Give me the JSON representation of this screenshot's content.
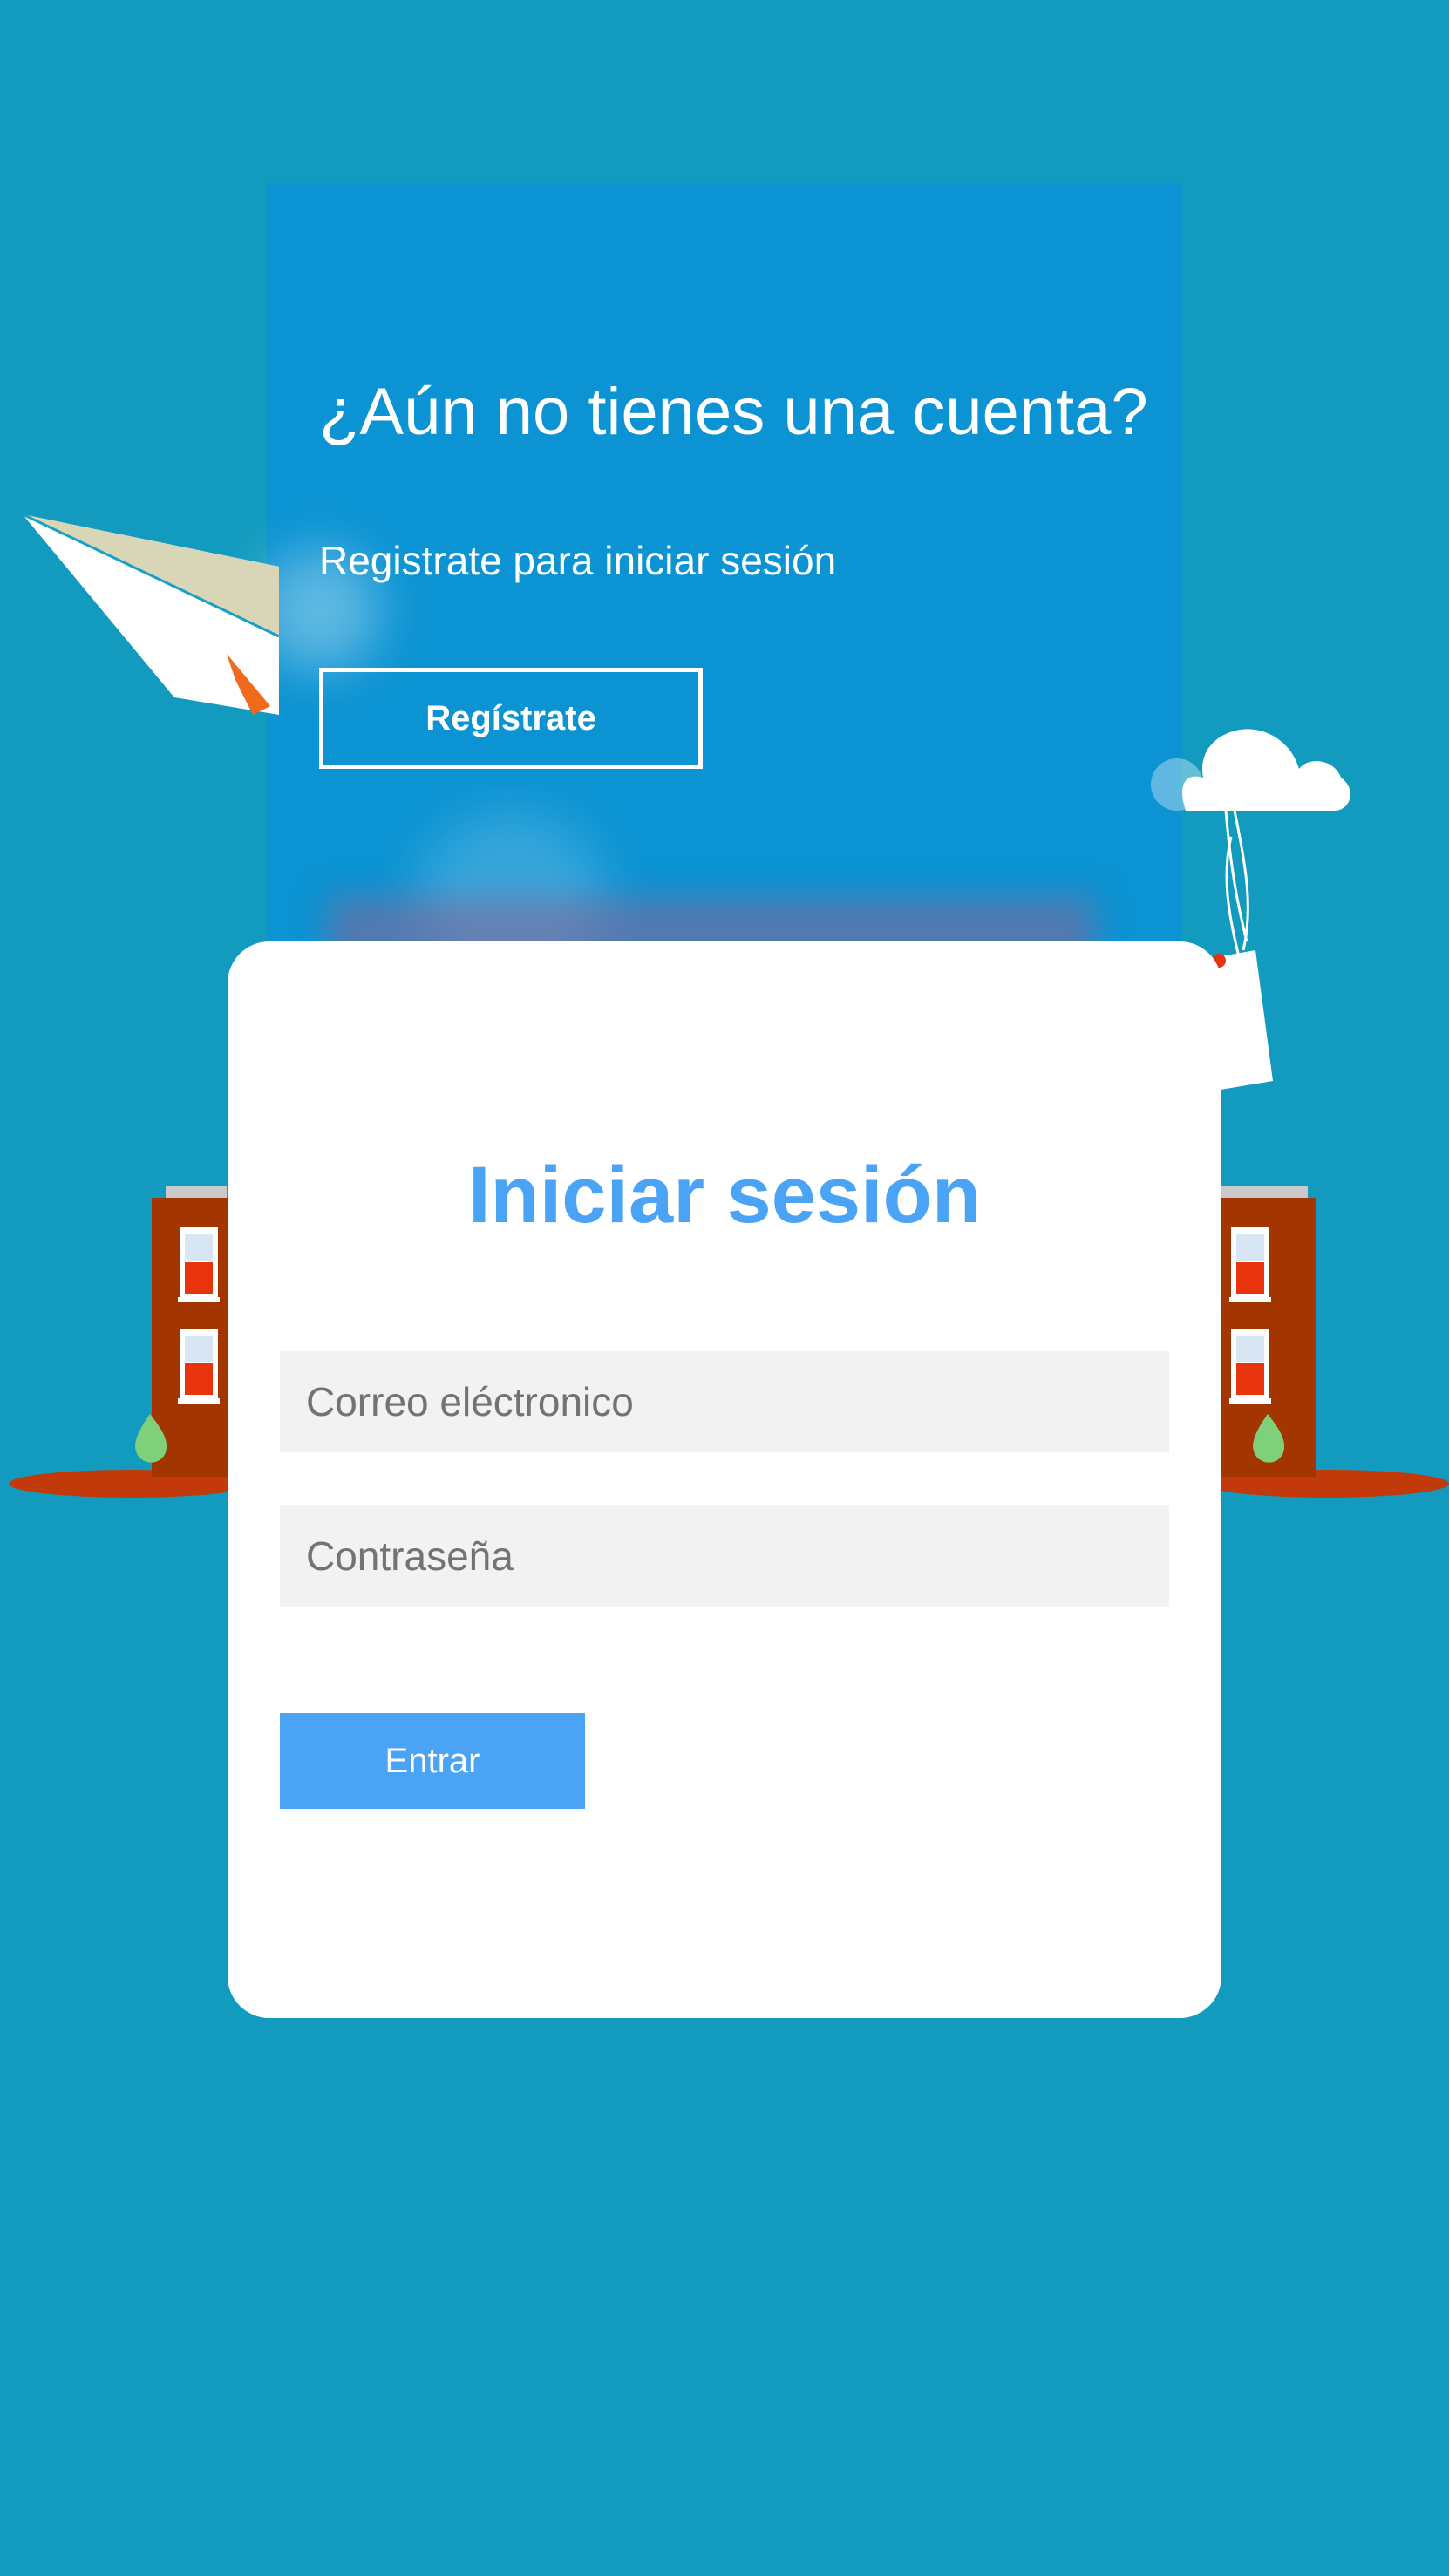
{
  "register": {
    "title": "¿Aún no tienes una cuenta?",
    "subtitle": "Registrate para iniciar sesión",
    "button_label": "Regístrate"
  },
  "login": {
    "title": "Iniciar sesión",
    "email_placeholder": "Correo eléctronico",
    "password_placeholder": "Contraseña",
    "submit_label": "Entrar"
  },
  "decorations": {
    "left_icon": "paper-plane-icon",
    "cloud_icon": "cloud-tag-icon",
    "building_icon": "building-icon"
  },
  "colors": {
    "background": "#129bbf",
    "register_panel": "#0b93d3",
    "accent": "#4aa3f4",
    "input_bg": "#f2f2f2",
    "building": "#a23500"
  }
}
